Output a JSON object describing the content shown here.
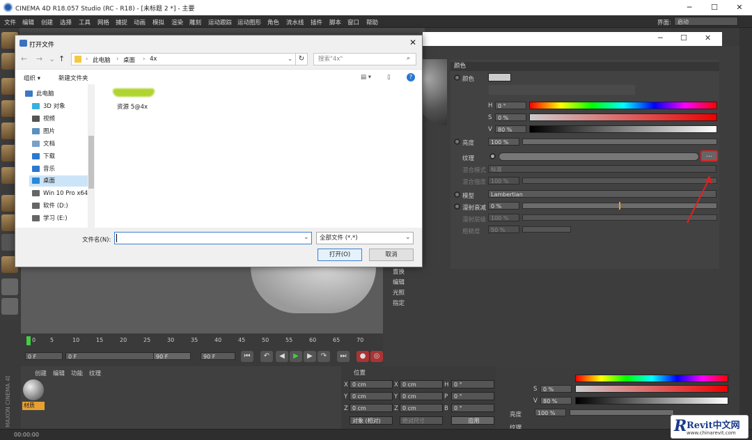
{
  "app": {
    "title": "CINEMA 4D R18.057 Studio (RC - R18) - [未标题 2 *] - 主要"
  },
  "menu": [
    "文件",
    "编辑",
    "创建",
    "选择",
    "工具",
    "网格",
    "捕捉",
    "动画",
    "模拟",
    "渲染",
    "雕刻",
    "运动跟踪",
    "运动图形",
    "角色",
    "流水线",
    "插件",
    "脚本",
    "窗口",
    "帮助"
  ],
  "layout": {
    "label": "界面:",
    "value": "启动"
  },
  "dialog": {
    "title": "打开文件",
    "breadcrumb": [
      "此电脑",
      "桌面",
      "4x"
    ],
    "search_placeholder": "搜索\"4x\"",
    "organize": "组织 ▾",
    "new_folder": "新建文件夹",
    "tree": [
      {
        "label": "此电脑",
        "color": "#3a78c8"
      },
      {
        "label": "3D 对象",
        "color": "#3ab0e0"
      },
      {
        "label": "视频",
        "color": "#555"
      },
      {
        "label": "图片",
        "color": "#5a90c0"
      },
      {
        "label": "文档",
        "color": "#7aa0c8"
      },
      {
        "label": "下载",
        "color": "#2a78d0"
      },
      {
        "label": "音乐",
        "color": "#2a78d0"
      },
      {
        "label": "桌面",
        "color": "#2a88d8"
      },
      {
        "label": "Win 10 Pro x64",
        "color": "#666"
      },
      {
        "label": "软件 (D:)",
        "color": "#666"
      },
      {
        "label": "学习 (E:)",
        "color": "#666"
      }
    ],
    "selected_index": 7,
    "file": "资源 5@4x",
    "filename_label": "文件名(N):",
    "filename_value": "",
    "filetype": "全部文件 (*.*)",
    "open": "打开(O)",
    "cancel": "取消"
  },
  "material": {
    "color_header": "颜色",
    "color_label": "颜色",
    "H": "0 °",
    "S": "0 %",
    "V": "80 %",
    "brightness_label": "亮度",
    "brightness": "100 %",
    "texture_label": "纹理",
    "texture_btn": "...",
    "blend_mode_label": "混合模式",
    "blend_mode": "标准",
    "blend_strength_label": "混合强度",
    "blend_strength": "100 %",
    "model_label": "模型",
    "model": "Lambertian",
    "diffuse_falloff_label": "漫射衰减",
    "diffuse_falloff": "0 %",
    "diffuse_level_label": "漫射层级",
    "diffuse_level": "100 %",
    "roughness_label": "粗糙度",
    "roughness": "50 %",
    "list": [
      "置换",
      "编辑",
      "光照",
      "指定"
    ]
  },
  "timeline": {
    "ticks": [
      "0",
      "5",
      "10",
      "15",
      "20",
      "25",
      "30",
      "35",
      "40",
      "45",
      "50",
      "55",
      "60",
      "65",
      "70"
    ],
    "start": "0 F",
    "cur": "0 F",
    "end": "90 F",
    "end2": "90 F"
  },
  "matmgr": {
    "menu": [
      "创建",
      "编辑",
      "功能",
      "纹理"
    ],
    "item": "材质"
  },
  "coords": {
    "header": "位置",
    "x": "0 cm",
    "y": "0 cm",
    "z": "0 cm",
    "h": "0 °",
    "p": "0 °",
    "b": "0 °",
    "mode": "对象 (相对)",
    "size": "绝对尺寸",
    "apply": "应用",
    "ax": "X",
    "ay": "Y",
    "az": "Z",
    "ah": "H",
    "ap": "P",
    "ab": "B"
  },
  "lower": {
    "S": "0 %",
    "V": "80 %",
    "brightness": "100 %",
    "bright_label": "亮度",
    "tex_label": "纹理"
  },
  "status": "00:00:00",
  "watermark": {
    "brand": "Revit中文网",
    "url": "www.chinarevit.com"
  }
}
